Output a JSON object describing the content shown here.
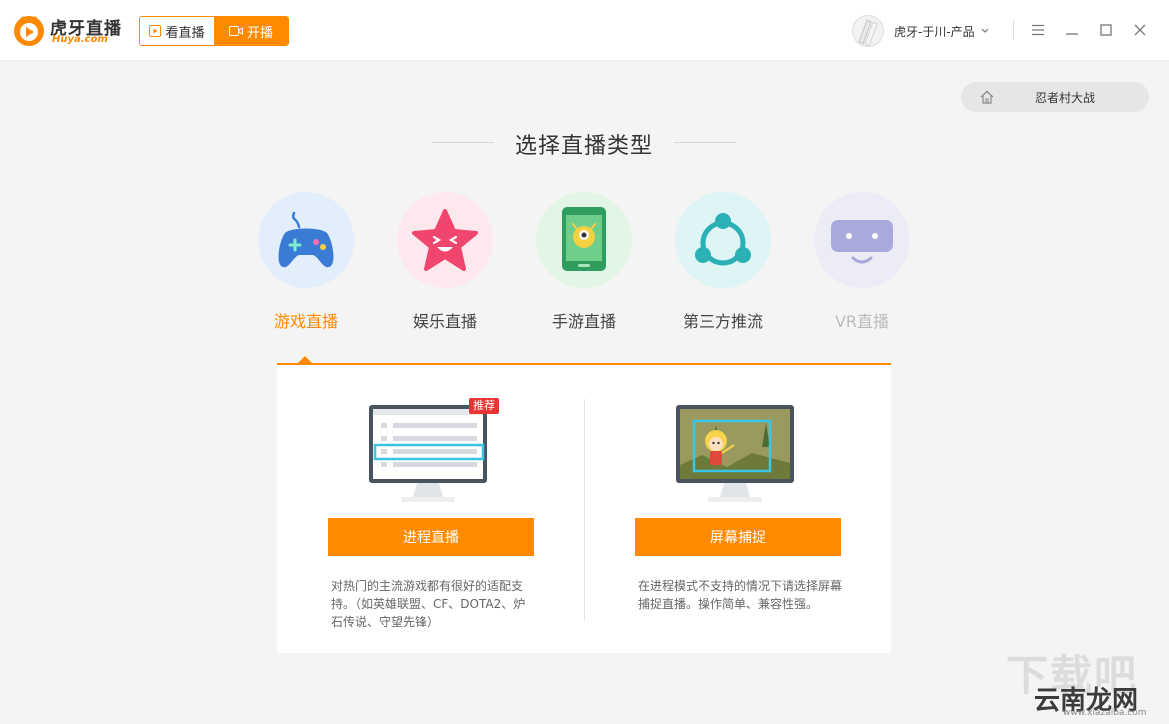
{
  "brand": {
    "name": "虎牙直播",
    "domain": "Huya.com",
    "accent": "#ff8a00"
  },
  "mode_toggle": {
    "watch_label": "看直播",
    "start_label": "开播"
  },
  "user": {
    "name": "虎牙-于川-产品"
  },
  "window_controls": [
    "menu-icon",
    "minimize-icon",
    "maximize-icon",
    "close-icon"
  ],
  "breadcrumb": {
    "text": "忍者村大战"
  },
  "heading": "选择直播类型",
  "types": [
    {
      "label": "游戏直播",
      "icon": "gamepad-icon",
      "state": "active"
    },
    {
      "label": "娱乐直播",
      "icon": "star-face-icon",
      "state": "normal"
    },
    {
      "label": "手游直播",
      "icon": "phone-icon",
      "state": "normal"
    },
    {
      "label": "第三方推流",
      "icon": "share-nodes-icon",
      "state": "normal"
    },
    {
      "label": "VR直播",
      "icon": "vr-headset-icon",
      "state": "disabled"
    }
  ],
  "options": [
    {
      "badge": "推荐",
      "button": "进程直播",
      "description": "对热门的主流游戏都有很好的适配支持。（如英雄联盟、CF、DOTA2、炉石传说、守望先锋）"
    },
    {
      "button": "屏幕捕捉",
      "description": "在进程模式不支持的情况下请选择屏幕捕捉直播。操作简单、兼容性强。"
    }
  ],
  "watermark": {
    "line1": "下载吧",
    "line2": "云南龙网",
    "line3": "www.xiazaiba.com"
  }
}
